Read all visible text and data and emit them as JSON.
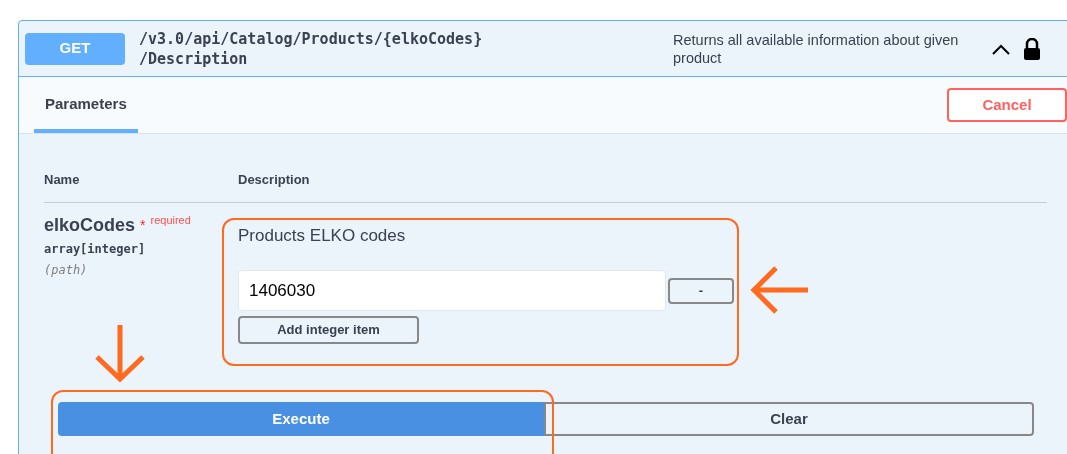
{
  "operation": {
    "method": "GET",
    "path_lines": [
      "/v3.0/api/Catalog/Products/{elkoCodes}",
      "/Description"
    ],
    "summary": "Returns all available information about given product",
    "expanded": true,
    "locked": true
  },
  "tabs": [
    {
      "label": "Parameters",
      "selected": true
    }
  ],
  "cancel_button": "Cancel",
  "table": {
    "columns": [
      "Name",
      "Description"
    ],
    "rows": [
      {
        "name": "elkoCodes",
        "required_mark": "*",
        "required": "required",
        "type": "array[integer]",
        "location": "(path)",
        "description": "Products ELKO codes",
        "items": [
          {
            "value": "1406030",
            "remove_button": "-"
          }
        ],
        "add_button": "Add integer item"
      }
    ]
  },
  "actions": [
    {
      "label": "Execute",
      "kind": "primary"
    },
    {
      "label": "Clear",
      "kind": "secondary"
    }
  ]
}
